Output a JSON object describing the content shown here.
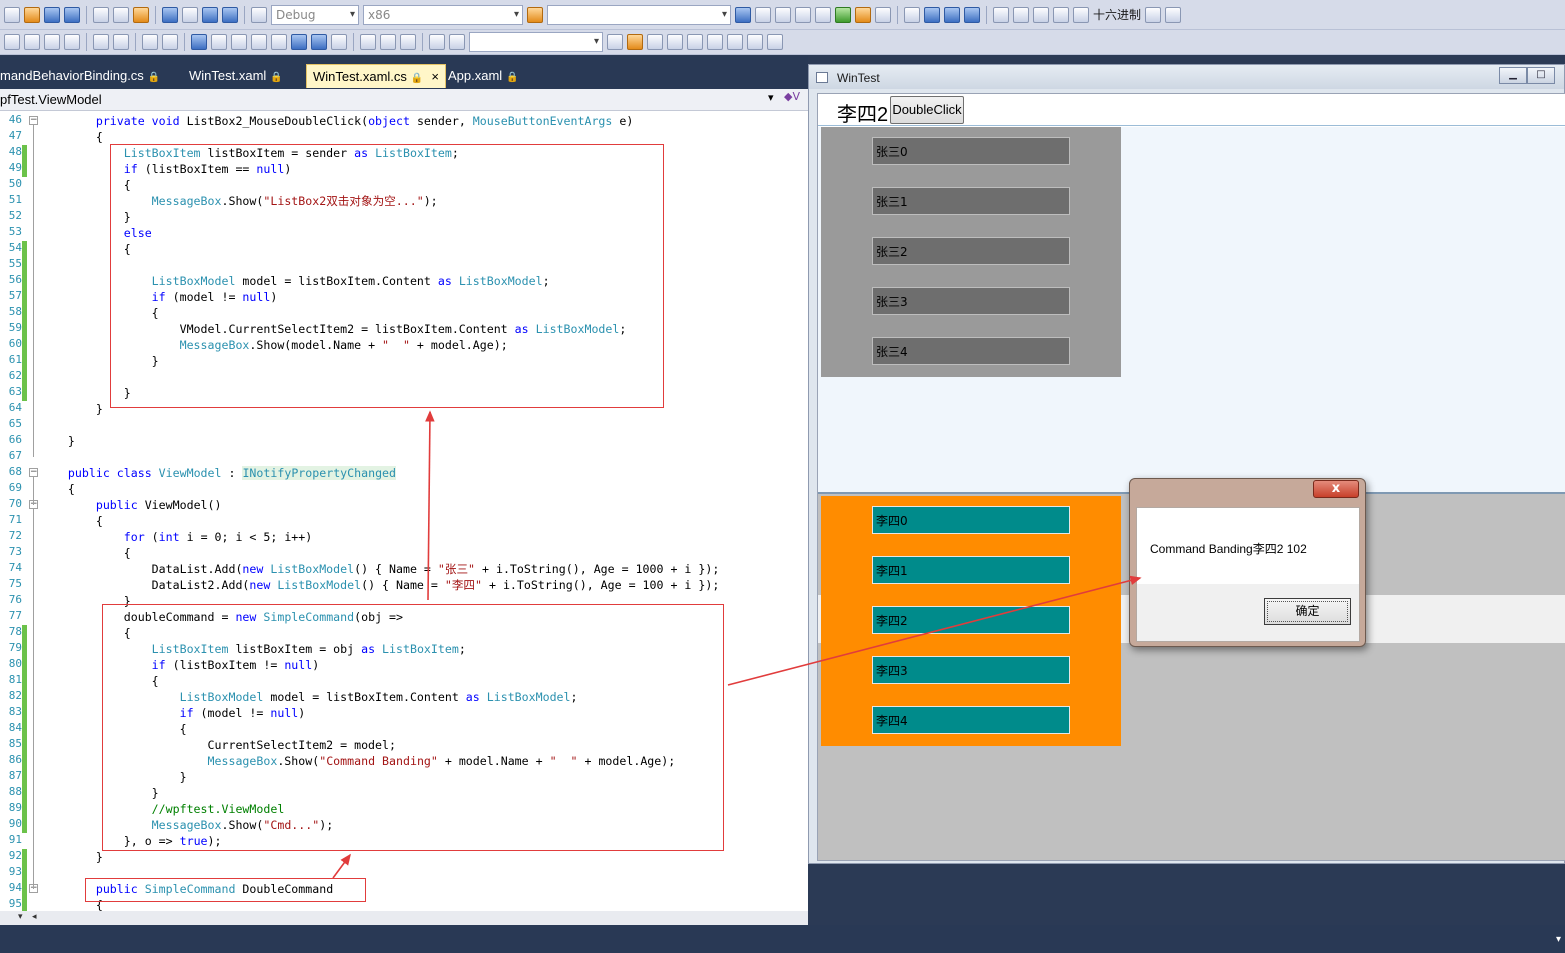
{
  "toolbar": {
    "config_combo": "Debug",
    "platform_combo": "x86",
    "search_combo": "",
    "hex_label": "十六进制",
    "combo2": ""
  },
  "tabs": [
    {
      "label": "mandBehaviorBinding.cs",
      "locked": true
    },
    {
      "label": "WinTest.xaml",
      "locked": true
    },
    {
      "label": "WinTest.xaml.cs",
      "locked": true,
      "active": true
    },
    {
      "label": "App.xaml",
      "locked": true
    }
  ],
  "tab_close": "×",
  "nav": {
    "type_selector": "pfTest.ViewModel",
    "member_selector": "V"
  },
  "code": {
    "first_line": 46,
    "lines": [
      [
        [
          "kw",
          "        private void "
        ],
        [
          "",
          "ListBox2_MouseDoubleClick("
        ],
        [
          "kw",
          "object"
        ],
        [
          "",
          " sender, "
        ],
        [
          "ty",
          "MouseButtonEventArgs"
        ],
        [
          "",
          " e)"
        ]
      ],
      [
        [
          "",
          "        {"
        ]
      ],
      [
        [
          "ty",
          "            ListBoxItem"
        ],
        [
          "",
          " listBoxItem = sender "
        ],
        [
          "kw",
          "as"
        ],
        [
          "",
          " "
        ],
        [
          "ty",
          "ListBoxItem"
        ],
        [
          "",
          ";"
        ]
      ],
      [
        [
          "kw",
          "            if"
        ],
        [
          "",
          " (listBoxItem == "
        ],
        [
          "kw",
          "null"
        ],
        [
          "",
          ")"
        ]
      ],
      [
        [
          "",
          "            {"
        ]
      ],
      [
        [
          "ty",
          "                MessageBox"
        ],
        [
          "",
          ".Show("
        ],
        [
          "st",
          "\"ListBox2双击对象为空...\""
        ],
        [
          "",
          ");"
        ]
      ],
      [
        [
          "",
          "            }"
        ]
      ],
      [
        [
          "kw",
          "            else"
        ]
      ],
      [
        [
          "",
          "            {"
        ]
      ],
      [
        [
          "",
          ""
        ]
      ],
      [
        [
          "ty",
          "                ListBoxModel"
        ],
        [
          "",
          " model = listBoxItem.Content "
        ],
        [
          "kw",
          "as"
        ],
        [
          "",
          " "
        ],
        [
          "ty",
          "ListBoxModel"
        ],
        [
          "",
          ";"
        ]
      ],
      [
        [
          "kw",
          "                if"
        ],
        [
          "",
          " (model != "
        ],
        [
          "kw",
          "null"
        ],
        [
          "",
          ")"
        ]
      ],
      [
        [
          "",
          "                {"
        ]
      ],
      [
        [
          "",
          "                    VModel.CurrentSelectItem2 = listBoxItem.Content "
        ],
        [
          "kw",
          "as"
        ],
        [
          "",
          " "
        ],
        [
          "ty",
          "ListBoxModel"
        ],
        [
          "",
          ";"
        ]
      ],
      [
        [
          "ty",
          "                    MessageBox"
        ],
        [
          "",
          ".Show(model.Name + "
        ],
        [
          "st",
          "\"  \""
        ],
        [
          "",
          " + model.Age);"
        ]
      ],
      [
        [
          "",
          "                }"
        ]
      ],
      [
        [
          "",
          ""
        ]
      ],
      [
        [
          "",
          "            }"
        ]
      ],
      [
        [
          "",
          "        }"
        ]
      ],
      [
        [
          "",
          ""
        ]
      ],
      [
        [
          "",
          "    }"
        ]
      ],
      [
        [
          "",
          ""
        ]
      ],
      [
        [
          "kw",
          "    public class "
        ],
        [
          "ty",
          "ViewModel"
        ],
        [
          "",
          " : "
        ],
        [
          "tyhl",
          "INotifyPropertyChanged"
        ]
      ],
      [
        [
          "",
          "    {"
        ]
      ],
      [
        [
          "kw",
          "        public "
        ],
        [
          "",
          "ViewModel()"
        ]
      ],
      [
        [
          "",
          "        {"
        ]
      ],
      [
        [
          "kw",
          "            for"
        ],
        [
          "",
          " ("
        ],
        [
          "kw",
          "int"
        ],
        [
          "",
          " i = 0; i < 5; i++)"
        ]
      ],
      [
        [
          "",
          "            {"
        ]
      ],
      [
        [
          "",
          "                DataList.Add("
        ],
        [
          "kw",
          "new "
        ],
        [
          "ty",
          "ListBoxModel"
        ],
        [
          "",
          "() { Name = "
        ],
        [
          "st",
          "\"张三\""
        ],
        [
          "",
          " + i.ToString(), Age = 1000 + i });"
        ]
      ],
      [
        [
          "",
          "                DataList2.Add("
        ],
        [
          "kw",
          "new "
        ],
        [
          "ty",
          "ListBoxModel"
        ],
        [
          "",
          "() { Name = "
        ],
        [
          "st",
          "\"李四\""
        ],
        [
          "",
          " + i.ToString(), Age = 100 + i });"
        ]
      ],
      [
        [
          "",
          "            }"
        ]
      ],
      [
        [
          "",
          "            doubleCommand = "
        ],
        [
          "kw",
          "new "
        ],
        [
          "ty",
          "SimpleCommand"
        ],
        [
          "",
          "(obj =>"
        ]
      ],
      [
        [
          "",
          "            {"
        ]
      ],
      [
        [
          "ty",
          "                ListBoxItem"
        ],
        [
          "",
          " listBoxItem = obj "
        ],
        [
          "kw",
          "as"
        ],
        [
          "",
          " "
        ],
        [
          "ty",
          "ListBoxItem"
        ],
        [
          "",
          ";"
        ]
      ],
      [
        [
          "kw",
          "                if"
        ],
        [
          "",
          " (listBoxItem != "
        ],
        [
          "kw",
          "null"
        ],
        [
          "",
          ")"
        ]
      ],
      [
        [
          "",
          "                {"
        ]
      ],
      [
        [
          "ty",
          "                    ListBoxModel"
        ],
        [
          "",
          " model = listBoxItem.Content "
        ],
        [
          "kw",
          "as"
        ],
        [
          "",
          " "
        ],
        [
          "ty",
          "ListBoxModel"
        ],
        [
          "",
          ";"
        ]
      ],
      [
        [
          "kw",
          "                    if"
        ],
        [
          "",
          " (model != "
        ],
        [
          "kw",
          "null"
        ],
        [
          "",
          ")"
        ]
      ],
      [
        [
          "",
          "                    {"
        ]
      ],
      [
        [
          "",
          "                        CurrentSelectItem2 = model;"
        ]
      ],
      [
        [
          "ty",
          "                        MessageBox"
        ],
        [
          "",
          ".Show("
        ],
        [
          "st",
          "\"Command Banding\""
        ],
        [
          "",
          " + model.Name + "
        ],
        [
          "st",
          "\"  \""
        ],
        [
          "",
          " + model.Age);"
        ]
      ],
      [
        [
          "",
          "                    }"
        ]
      ],
      [
        [
          "",
          "                }"
        ]
      ],
      [
        [
          "cm",
          "                //wpftest.ViewModel"
        ]
      ],
      [
        [
          "ty",
          "                MessageBox"
        ],
        [
          "",
          ".Show("
        ],
        [
          "st",
          "\"Cmd...\""
        ],
        [
          "",
          ");"
        ]
      ],
      [
        [
          "",
          "            }, o => "
        ],
        [
          "kw",
          "true"
        ],
        [
          "",
          ");"
        ]
      ],
      [
        [
          "",
          "        }"
        ]
      ],
      [
        [
          "",
          ""
        ]
      ],
      [
        [
          "kw",
          "        public "
        ],
        [
          "ty",
          "SimpleCommand"
        ],
        [
          "",
          " DoubleCommand"
        ]
      ],
      [
        [
          "",
          "        {"
        ]
      ]
    ]
  },
  "wintest": {
    "title": "WinTest",
    "header_name": "李四2",
    "double_click_button": "DoubleClick",
    "list1": [
      "张三0",
      "张三1",
      "张三2",
      "张三3",
      "张三4"
    ],
    "list2": [
      "李四0",
      "李四1",
      "李四2",
      "李四3",
      "李四4"
    ]
  },
  "messagebox": {
    "close_glyph": "x",
    "text": "Command Banding李四2  102",
    "ok_label": "确定"
  },
  "colors": {
    "list1_bg": "#9a9a9a",
    "list1_item": "#6e6e6e",
    "list2_bg": "#ff8c00",
    "list2_item": "#008b8b",
    "annotation_red": "#e13c3c"
  }
}
